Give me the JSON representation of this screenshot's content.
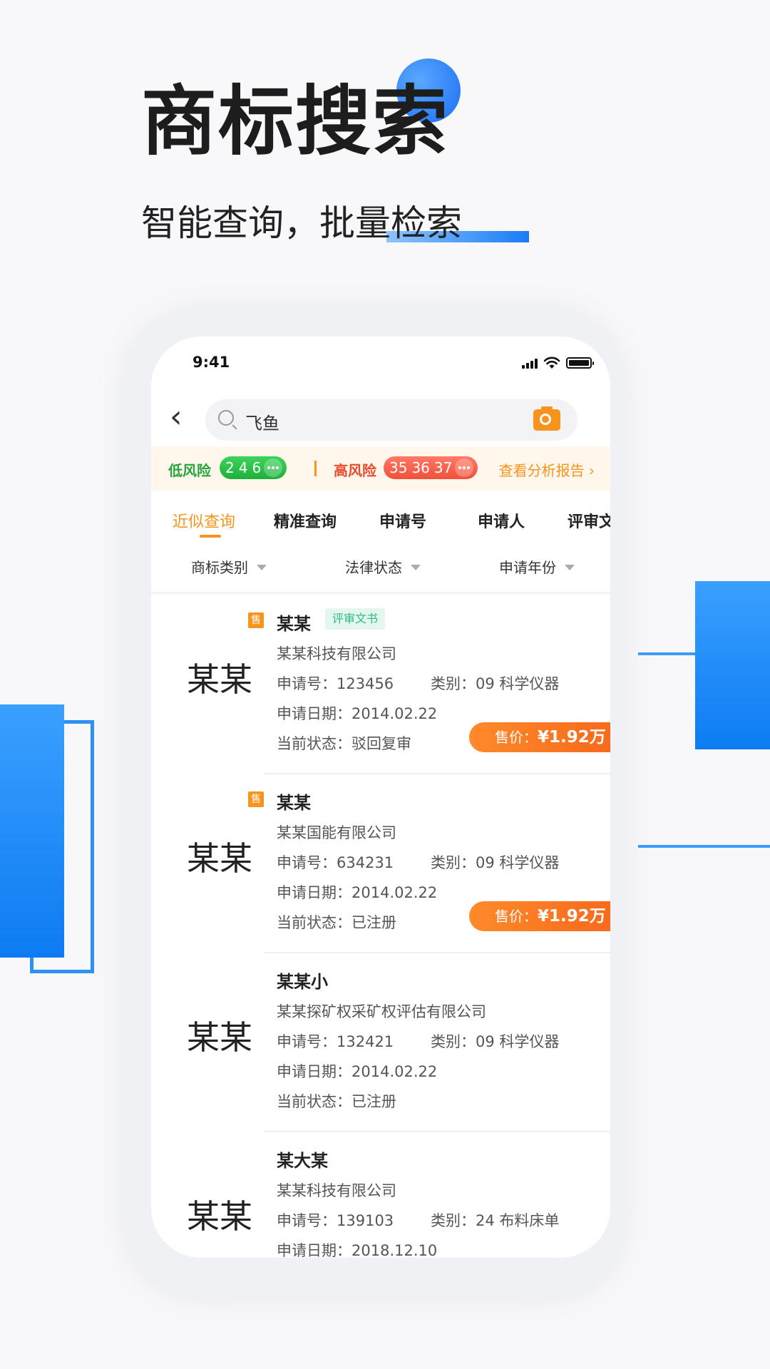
{
  "hero": {
    "title": "商标搜索",
    "subtitle": "智能查询，批量检索"
  },
  "status_bar": {
    "time": "9:41"
  },
  "search": {
    "query": "飞鱼"
  },
  "risk": {
    "low_label": "低风险",
    "low_numbers": [
      "2",
      "4",
      "6"
    ],
    "high_label": "高风险",
    "high_numbers": [
      "35",
      "36",
      "37"
    ],
    "report_link": "查看分析报告 ›"
  },
  "tabs": [
    {
      "label": "近似查询",
      "active": true
    },
    {
      "label": "精准查询"
    },
    {
      "label": "申请号"
    },
    {
      "label": "申请人"
    },
    {
      "label": "评审文"
    }
  ],
  "filters": [
    "商标类别",
    "法律状态",
    "申请年份"
  ],
  "results": [
    {
      "logo_text": "某某",
      "for_sale_badge": "售",
      "name": "某某",
      "doc_badge": "评审文书",
      "company": "某某科技有限公司",
      "app_no": "申请号：123456",
      "category": "类别：09 科学仪器",
      "app_date": "申请日期：2014.02.22",
      "status": "当前状态：驳回复审",
      "price_label": "售价：",
      "price": "¥1.92万"
    },
    {
      "logo_text": "某某",
      "for_sale_badge": "售",
      "name": "某某",
      "company": "某某国能有限公司",
      "app_no": "申请号：634231",
      "category": "类别：09 科学仪器",
      "app_date": "申请日期：2014.02.22",
      "status": "当前状态：已注册",
      "price_label": "售价：",
      "price": "¥1.92万"
    },
    {
      "logo_text": "某某",
      "name": "某某小",
      "company": "某某探矿权采矿权评估有限公司",
      "app_no": "申请号：132421",
      "category": "类别：09 科学仪器",
      "app_date": "申请日期：2014.02.22",
      "status": "当前状态：已注册"
    },
    {
      "logo_text": "某某",
      "name": "某大某",
      "company": "某某科技有限公司",
      "app_no": "申请号：139103",
      "category": "类别：24 布料床单",
      "app_date": "申请日期：2018.12.10"
    }
  ],
  "colors": {
    "accent_orange": "#f7941d",
    "brand_blue": "#1a7cf5",
    "low_risk_green": "#26a53b",
    "high_risk_red": "#e94a2e"
  }
}
